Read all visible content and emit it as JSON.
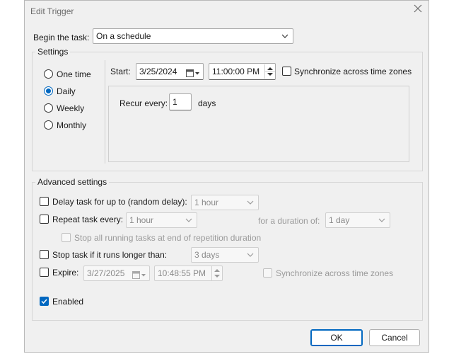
{
  "window": {
    "title": "Edit Trigger",
    "close_icon": "close-icon"
  },
  "begin": {
    "label": "Begin the task:",
    "value": "On a schedule"
  },
  "settings": {
    "legend": "Settings",
    "frequency_options": [
      {
        "label": "One time",
        "selected": false
      },
      {
        "label": "Daily",
        "selected": true
      },
      {
        "label": "Weekly",
        "selected": false
      },
      {
        "label": "Monthly",
        "selected": false
      }
    ],
    "start_label": "Start:",
    "start_date": "3/25/2024",
    "start_time": "11:00:00 PM",
    "sync_label": "Synchronize across time zones",
    "sync_checked": false,
    "recur_label": "Recur every:",
    "recur_value": "1",
    "recur_unit": "days"
  },
  "advanced": {
    "legend": "Advanced settings",
    "delay": {
      "label": "Delay task for up to (random delay):",
      "value": "1 hour",
      "checked": false
    },
    "repeat": {
      "label": "Repeat task every:",
      "value": "1 hour",
      "checked": false,
      "duration_label": "for a duration of:",
      "duration_value": "1 day"
    },
    "stop_all": {
      "label": "Stop all running tasks at end of repetition duration",
      "checked": false
    },
    "stop_longer": {
      "label": "Stop task if it runs longer than:",
      "value": "3 days",
      "checked": false
    },
    "expire": {
      "label": "Expire:",
      "date": "3/27/2025",
      "time": "10:48:55 PM",
      "checked": false,
      "sync_label": "Synchronize across time zones"
    },
    "enabled": {
      "label": "Enabled",
      "checked": true
    }
  },
  "buttons": {
    "ok": "OK",
    "cancel": "Cancel"
  },
  "colors": {
    "accent": "#0067c0",
    "dialog_bg": "#f0f0f0",
    "border": "#d6d6d6"
  }
}
